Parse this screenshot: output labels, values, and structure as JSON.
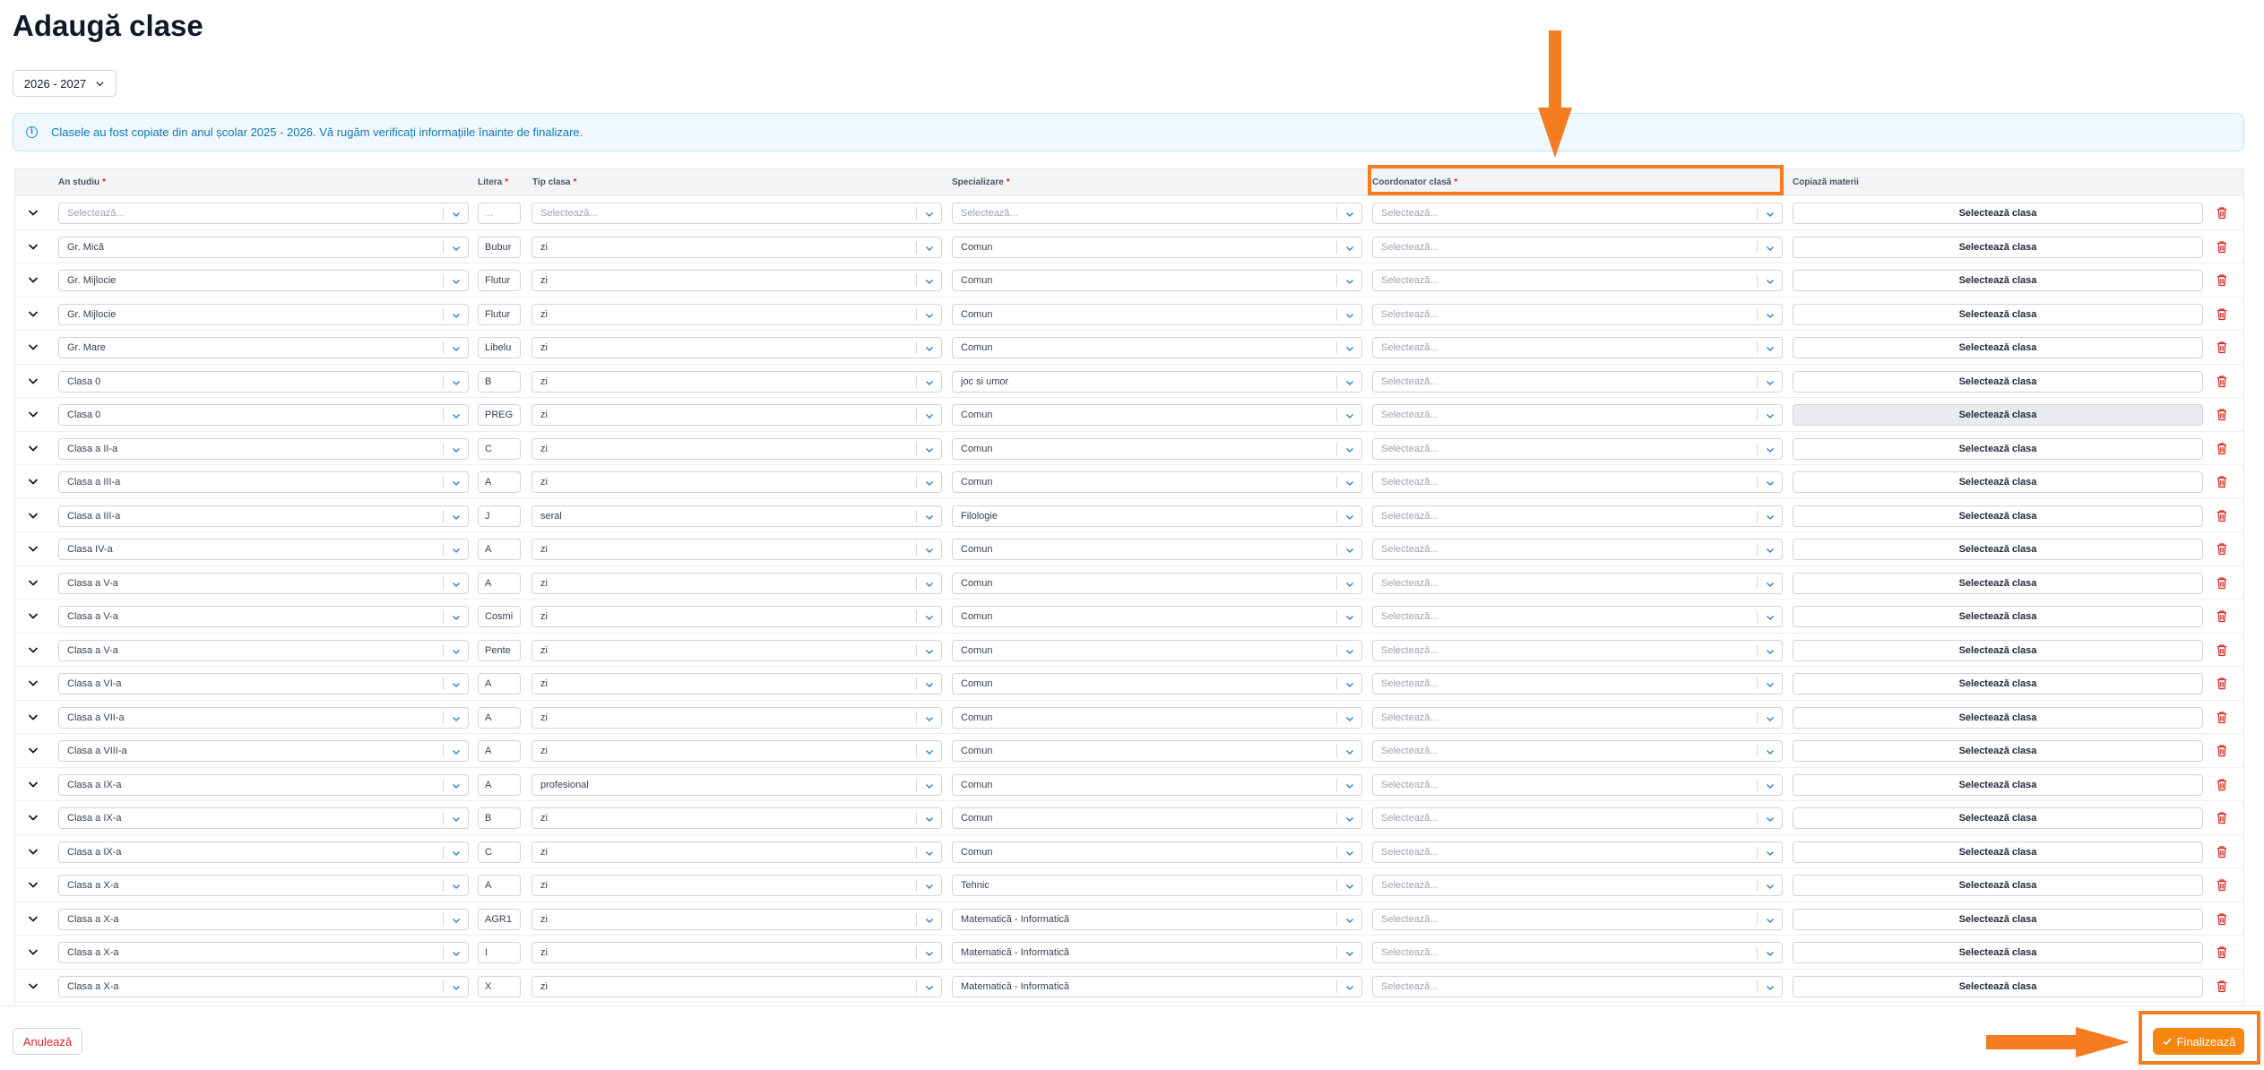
{
  "page": {
    "title": "Adaugă clase"
  },
  "year_select": {
    "value": "2026 - 2027"
  },
  "info": {
    "message": "Clasele au fost copiate din anul școlar 2025 - 2026. Vă rugăm verificați informațiile înainte de finalizare."
  },
  "table": {
    "headers": {
      "an_studiu": "An studiu",
      "litera": "Litera",
      "tip_clasa": "Tip clasa",
      "specializare": "Specializare",
      "coordonator": "Coordonator clasă",
      "copiaza": "Copiază materii"
    },
    "required_mark": "*",
    "placeholder_select": "Selectează...",
    "placeholder_litera": "...",
    "copy_label": "Selectează clasa",
    "rows": [
      {
        "an": "",
        "lit": "",
        "tip": "",
        "spec": ""
      },
      {
        "an": "Gr. Mică",
        "lit": "Bubur",
        "tip": "zi",
        "spec": "Comun"
      },
      {
        "an": "Gr. Mijlocie",
        "lit": "Flutur",
        "tip": "zi",
        "spec": "Comun"
      },
      {
        "an": "Gr. Mijlocie",
        "lit": "Flutur",
        "tip": "zi",
        "spec": "Comun"
      },
      {
        "an": "Gr. Mare",
        "lit": "Libelu",
        "tip": "zi",
        "spec": "Comun"
      },
      {
        "an": "Clasa 0",
        "lit": "B",
        "tip": "zi",
        "spec": "joc si umor"
      },
      {
        "an": "Clasa 0",
        "lit": "PREG",
        "tip": "zi",
        "spec": "Comun",
        "copy_disabled": true
      },
      {
        "an": "Clasa a II-a",
        "lit": "C",
        "tip": "zi",
        "spec": "Comun"
      },
      {
        "an": "Clasa a III-a",
        "lit": "A",
        "tip": "zi",
        "spec": "Comun"
      },
      {
        "an": "Clasa a III-a",
        "lit": "J",
        "tip": "seral",
        "spec": "Filologie"
      },
      {
        "an": "Clasa IV-a",
        "lit": "A",
        "tip": "zi",
        "spec": "Comun"
      },
      {
        "an": "Clasa a V-a",
        "lit": "A",
        "tip": "zi",
        "spec": "Comun"
      },
      {
        "an": "Clasa a V-a",
        "lit": "Cosmi",
        "tip": "zi",
        "spec": "Comun"
      },
      {
        "an": "Clasa a V-a",
        "lit": "Pente",
        "tip": "zi",
        "spec": "Comun"
      },
      {
        "an": "Clasa a VI-a",
        "lit": "A",
        "tip": "zi",
        "spec": "Comun"
      },
      {
        "an": "Clasa a VII-a",
        "lit": "A",
        "tip": "zi",
        "spec": "Comun"
      },
      {
        "an": "Clasa a VIII-a",
        "lit": "A",
        "tip": "zi",
        "spec": "Comun"
      },
      {
        "an": "Clasa a IX-a",
        "lit": "A",
        "tip": "profesional",
        "spec": "Comun"
      },
      {
        "an": "Clasa a IX-a",
        "lit": "B",
        "tip": "zi",
        "spec": "Comun"
      },
      {
        "an": "Clasa a IX-a",
        "lit": "C",
        "tip": "zi",
        "spec": "Comun"
      },
      {
        "an": "Clasa a X-a",
        "lit": "A",
        "tip": "zi",
        "spec": "Tehnic"
      },
      {
        "an": "Clasa a X-a",
        "lit": "AGR1",
        "tip": "zi",
        "spec": "Matematică - Informatică"
      },
      {
        "an": "Clasa a X-a",
        "lit": "I",
        "tip": "zi",
        "spec": "Matematică - Informatică"
      },
      {
        "an": "Clasa a X-a",
        "lit": "X",
        "tip": "zi",
        "spec": "Matematică - Informatică"
      }
    ]
  },
  "footer": {
    "cancel_label": "Anulează",
    "finalize_label": "Finalizează"
  },
  "colors": {
    "accent": "#f5870f",
    "highlight": "#f57c20",
    "danger": "#dc2626",
    "info": "#1477b0"
  }
}
